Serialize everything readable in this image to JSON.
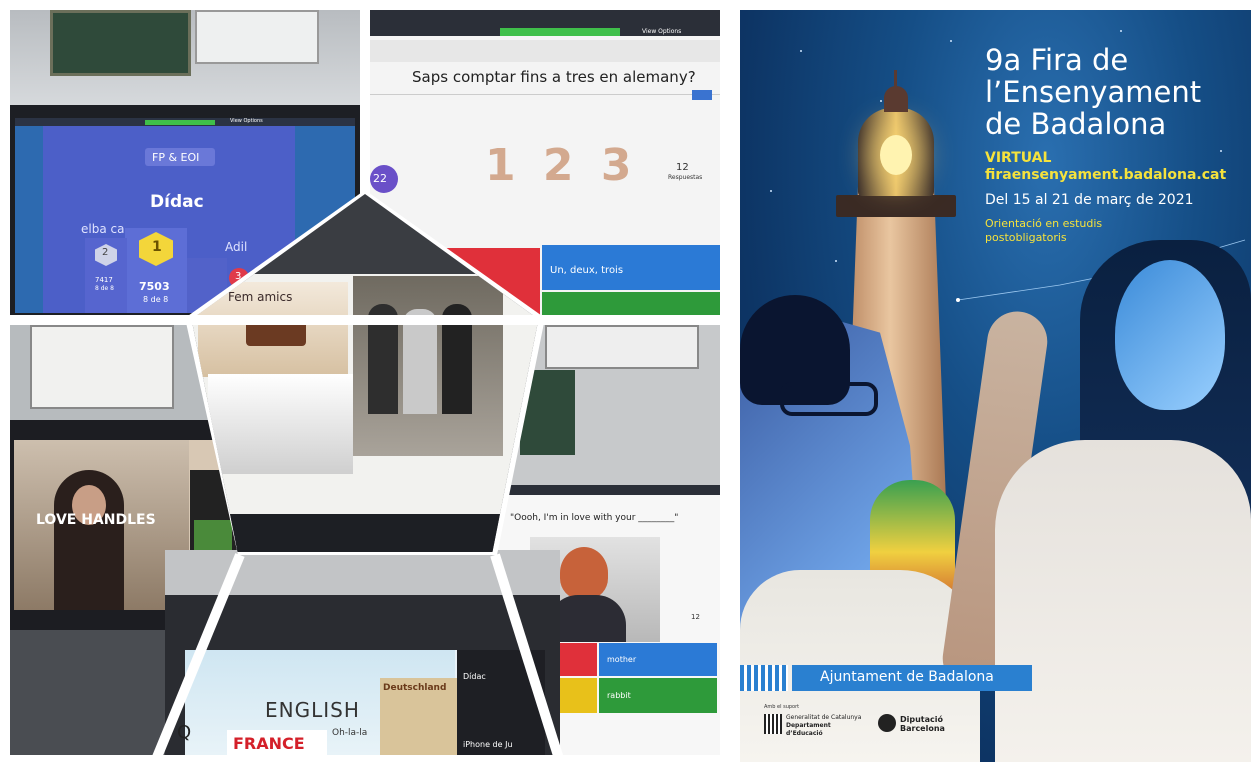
{
  "collage": {
    "quiz_question": "Saps comptar fins a tres en alemany?",
    "quiz_number_display": "1 2 3",
    "quiz_counter": "22",
    "quiz_answers_count": "12",
    "quiz_answers_label": "Respuestas",
    "quiz_option_1": "Un, deux, trois",
    "podium_category": "FP & EOI",
    "podium_winner": "Dídac",
    "podium_left_name": "elba ca",
    "podium_right_name": "Adil",
    "podium_rank_1": "1",
    "podium_rank_2": "2",
    "podium_rank_3": "3",
    "podium_score_1": "7503",
    "podium_score_1_sub": "8 de 8",
    "podium_score_2": "7417",
    "podium_score_2_sub": "8 de 8",
    "center_caption": "Fem amics",
    "video_caption": "LOVE HANDLES",
    "song_prompt": "\"Oooh, I'm in love with your ________\"",
    "song_answers_count": "12",
    "song_option_1": "mother",
    "song_option_2": "rabbit",
    "bottom_english": "ENGLISH",
    "bottom_deutschland": "Deutschland",
    "bottom_france": "FRANCE",
    "bottom_ohlala": "Oh-la-la",
    "bottom_q": "Q",
    "bottom_didac": "Dídac",
    "bottom_iphone": "iPhone de Ju",
    "view_options": "View Options"
  },
  "poster": {
    "title_line_1": "9a Fira de",
    "title_line_2": "l’Ensenyament",
    "title_line_3": "de Badalona",
    "virtual": "VIRTUAL",
    "url": "firaensenyament.badalona.cat",
    "dates": "Del 15 al 21 de març de 2021",
    "orientation_line_1": "Orientació en estudis",
    "orientation_line_2": "postobligatoris",
    "organizer": "Ajuntament de Badalona",
    "support_label": "Amb el suport",
    "generalitat_1": "Generalitat de Catalunya",
    "generalitat_2": "Departament",
    "generalitat_3": "d’Educació",
    "diputacio_1": "Diputació",
    "diputacio_2": "Barcelona"
  },
  "colors": {
    "poster_blue": "#0d3565",
    "poster_yellow": "#f5e23c",
    "organizer_blue": "#2a80d0",
    "quiz_red": "#e0303a",
    "quiz_blue": "#2b7ad6",
    "quiz_green": "#2e9a3a",
    "quiz_yellow": "#e8c11a",
    "kahoot_purple": "#4a3aa0"
  }
}
